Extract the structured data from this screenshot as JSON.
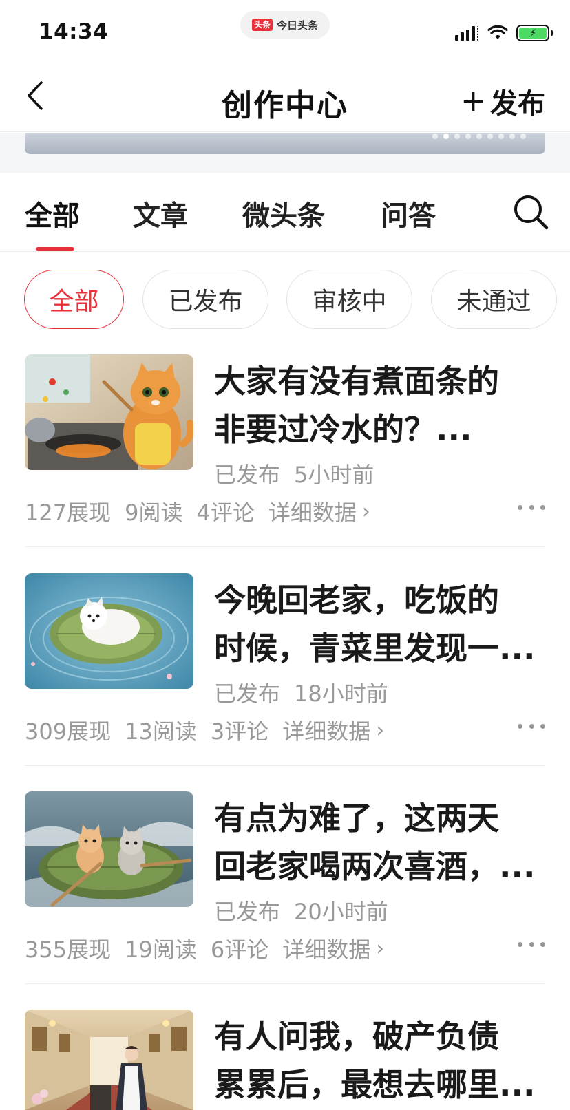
{
  "status_bar": {
    "time": "14:34",
    "app_badge_logo": "头条",
    "app_badge_name": "今日头条",
    "battery_icon": "battery-charging-icon"
  },
  "nav": {
    "title": "创作中心",
    "publish_label": "发布",
    "publish_plus": "+"
  },
  "banner": {
    "dots": 9,
    "active_dot": 2
  },
  "tabs": [
    {
      "label": "全部",
      "active": true
    },
    {
      "label": "文章",
      "active": false
    },
    {
      "label": "微头条",
      "active": false
    },
    {
      "label": "问答",
      "active": false
    }
  ],
  "filters": [
    {
      "label": "全部",
      "active": true
    },
    {
      "label": "已发布",
      "active": false
    },
    {
      "label": "审核中",
      "active": false
    },
    {
      "label": "未通过",
      "active": false
    }
  ],
  "articles": [
    {
      "title_line1": "大家有没有煮面条的",
      "title_line2": "非要过冷水的？...",
      "status": "已发布",
      "time": "5小时前",
      "impressions": "127展现",
      "reads": "9阅读",
      "comments": "4评论",
      "detail": "详细数据",
      "thumb": "cat-cooking"
    },
    {
      "title_line1": "今晚回老家，吃饭的",
      "title_line2": "时候，青菜里发现一...",
      "status": "已发布",
      "time": "18小时前",
      "impressions": "309展现",
      "reads": "13阅读",
      "comments": "3评论",
      "detail": "详细数据",
      "thumb": "dog-on-leaf"
    },
    {
      "title_line1": "有点为难了，这两天",
      "title_line2": "回老家喝两次喜酒，...",
      "status": "已发布",
      "time": "20小时前",
      "impressions": "355展现",
      "reads": "19阅读",
      "comments": "6评论",
      "detail": "详细数据",
      "thumb": "kittens-rowing"
    },
    {
      "title_line1": "有人问我，破产负债",
      "title_line2": "累累后，最想去哪里...",
      "thumb": "maid-hallway"
    }
  ],
  "colors": {
    "accent": "#e8313a",
    "muted_text": "#999999",
    "title_text": "#1a1a1a"
  }
}
